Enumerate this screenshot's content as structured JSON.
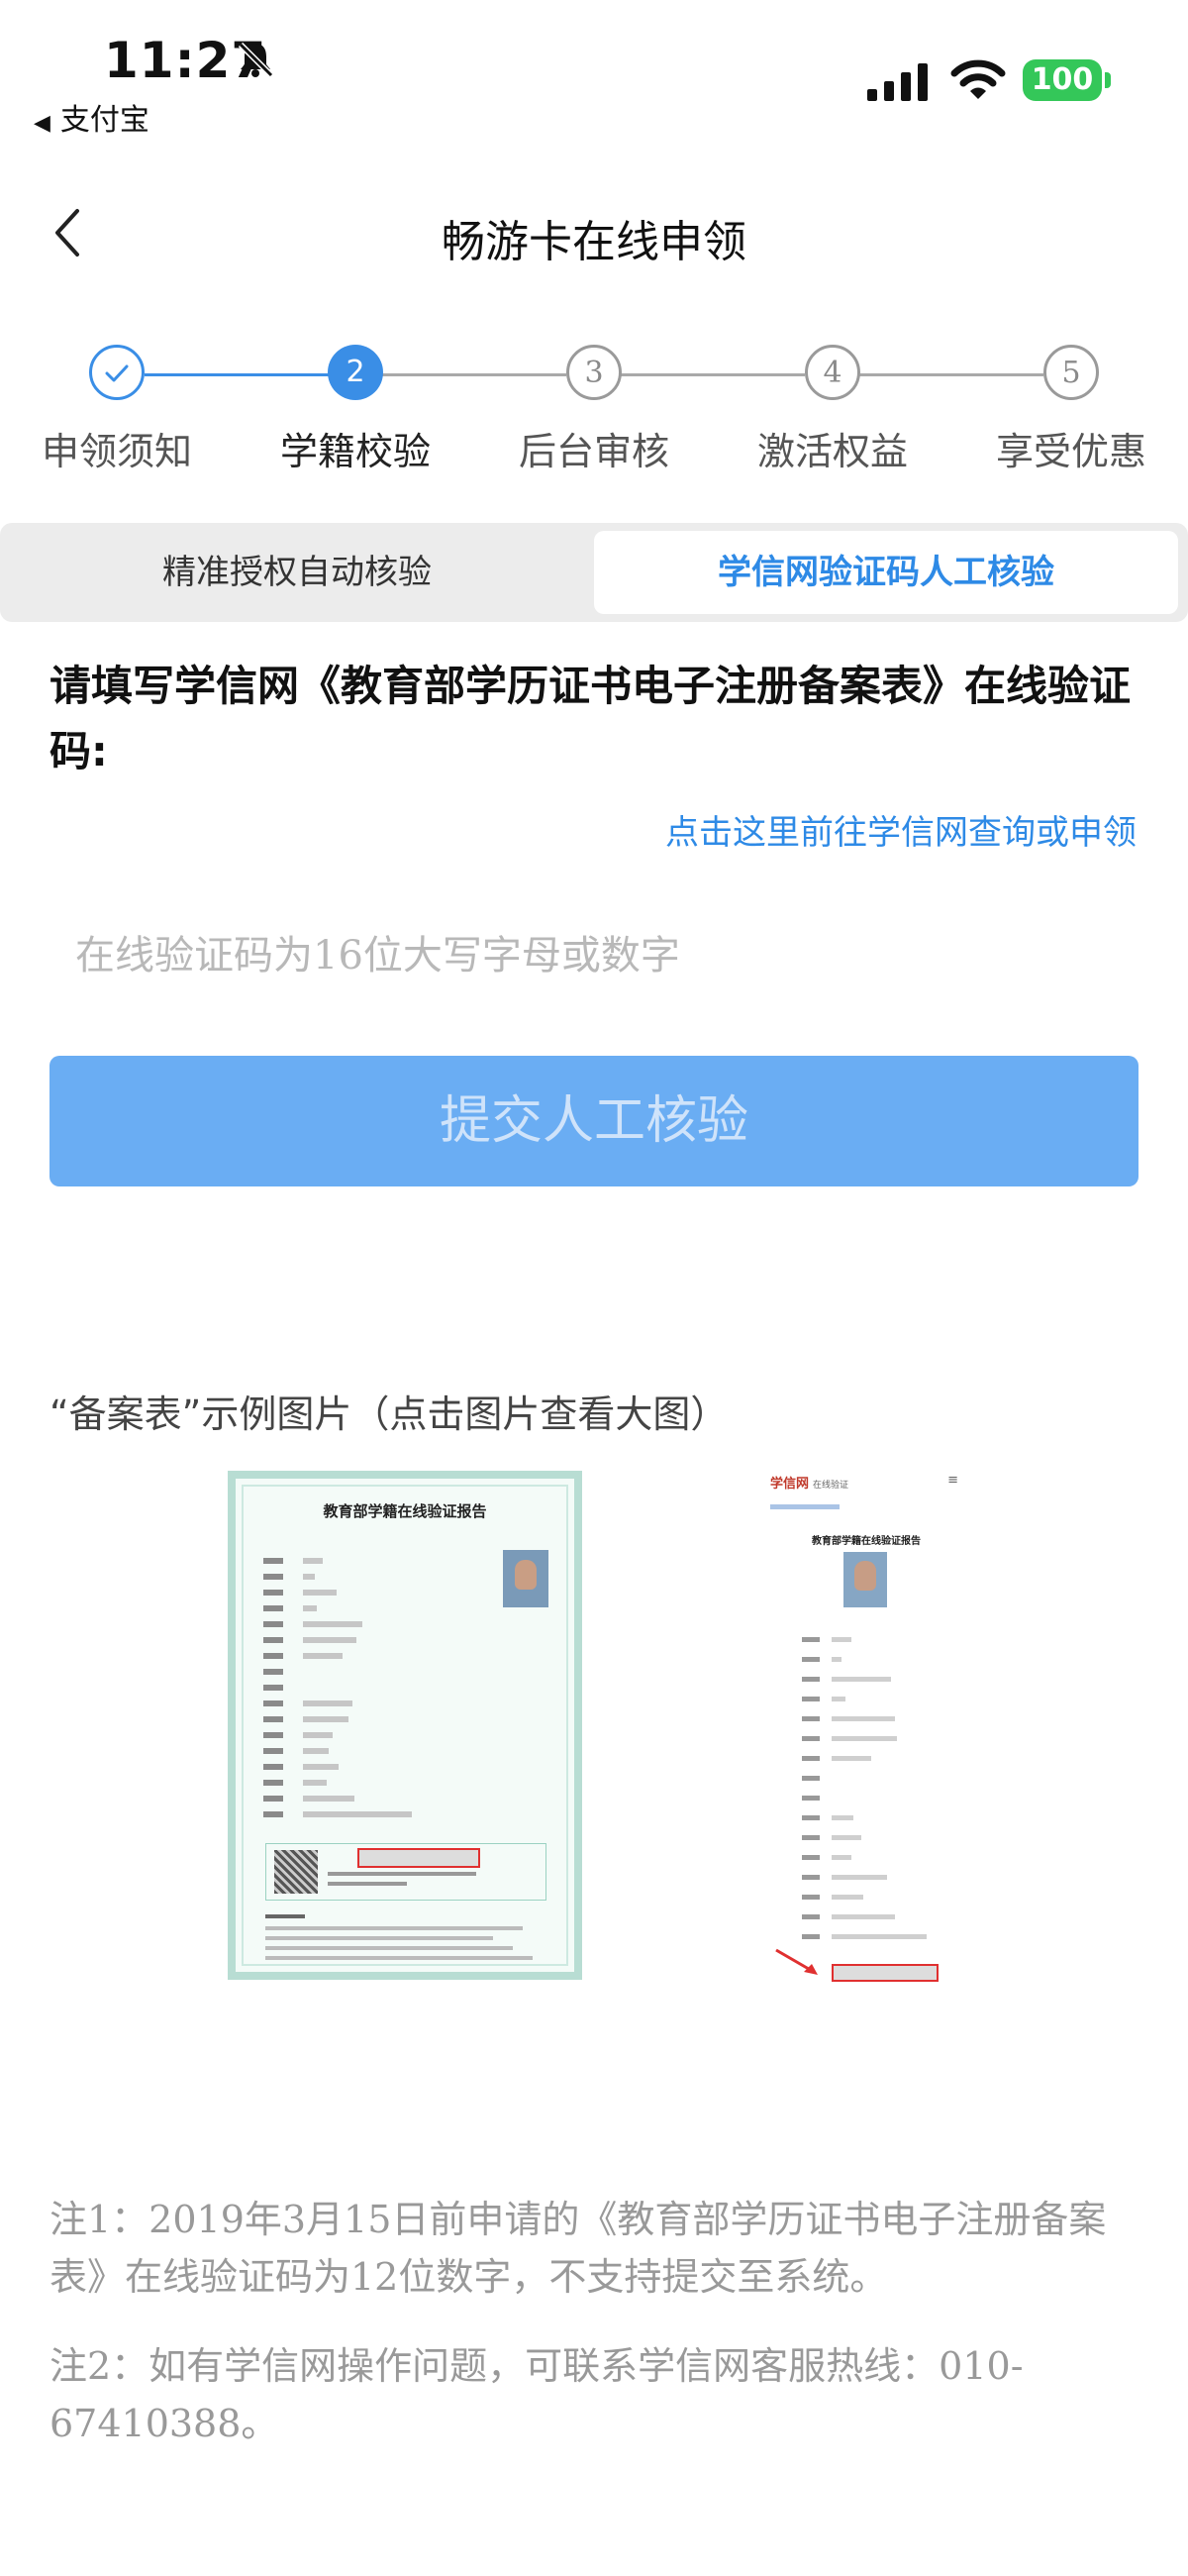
{
  "status_bar": {
    "time": "11:27",
    "back_app": "支付宝",
    "battery": "100",
    "icons": [
      "bell-slash-icon",
      "signal-icon",
      "wifi-icon",
      "battery-icon"
    ]
  },
  "nav": {
    "title": "畅游卡在线申领",
    "back_icon": "chevron-left-icon"
  },
  "stepper": {
    "steps": [
      {
        "number": "",
        "label": "申领须知",
        "state": "done"
      },
      {
        "number": "2",
        "label": "学籍校验",
        "state": "active"
      },
      {
        "number": "3",
        "label": "后台审核",
        "state": "todo"
      },
      {
        "number": "4",
        "label": "激活权益",
        "state": "todo"
      },
      {
        "number": "5",
        "label": "享受优惠",
        "state": "todo"
      }
    ],
    "active_color": "#3a8ee6"
  },
  "tabs": {
    "left": "精准授权自动核验",
    "right": "学信网验证码人工核验",
    "selected": "right"
  },
  "form": {
    "instruction": "请填写学信网《教育部学历证书电子注册备案表》在线验证码:",
    "link_text": "点击这里前往学信网查询或申领",
    "placeholder": "在线验证码为16位大写字母或数字",
    "value": "",
    "submit": "提交人工核验"
  },
  "examples": {
    "title": "“备案表”示例图片（点击图片查看大图）",
    "image1_title": "教育部学籍在线验证报告",
    "image2_logo": "学信网",
    "image2_logo_sub": "在线验证",
    "image2_title": "教育部学籍在线验证报告"
  },
  "notes": {
    "note1": "注1：2019年3月15日前申请的《教育部学历证书电子注册备案表》在线验证码为12位数字，不支持提交至系统。",
    "note2": "注2：如有学信网操作问题，可联系学信网客服热线：010-67410388。"
  },
  "colors": {
    "accent": "#2e8ae6",
    "button_disabled": "#6aadf3",
    "battery": "#34c759"
  }
}
